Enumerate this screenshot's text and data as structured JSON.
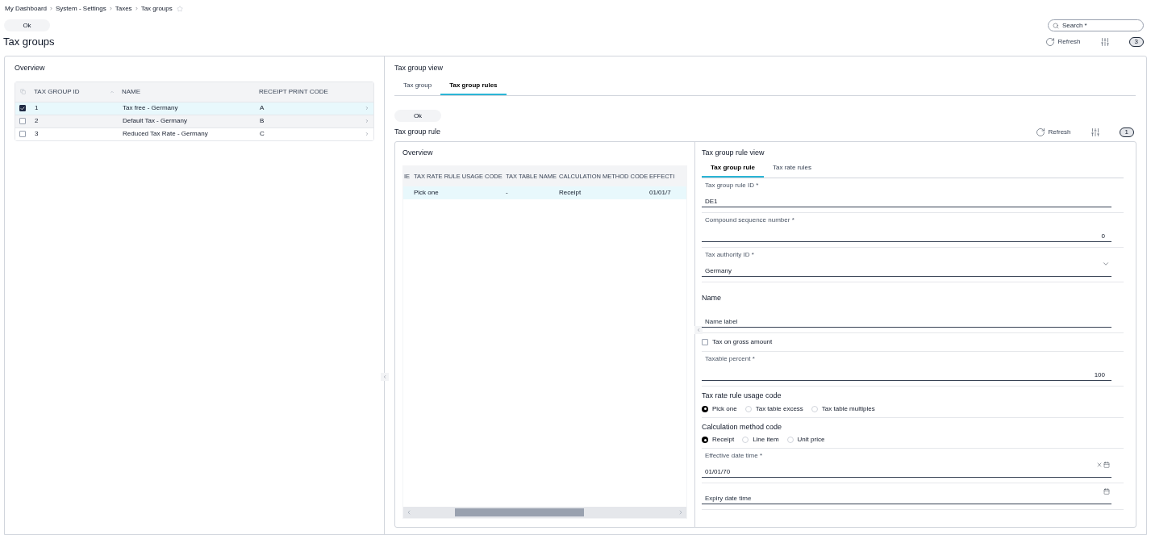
{
  "breadcrumb": [
    {
      "label": "My Dashboard"
    },
    {
      "label": "System - Settings"
    },
    {
      "label": "Taxes"
    },
    {
      "label": "Tax groups"
    }
  ],
  "favorite": false,
  "ok_button": "Ok",
  "search": {
    "placeholder": "Search *"
  },
  "page_title": "Tax groups",
  "page_actions": {
    "refresh": "Refresh",
    "count": "3"
  },
  "overview": {
    "title": "Overview",
    "columns": [
      "TAX GROUP ID",
      "NAME",
      "RECEIPT PRINT CODE"
    ],
    "rows": [
      {
        "cells": [
          "1",
          "Tax free - Germany",
          "A"
        ],
        "selected": true
      },
      {
        "cells": [
          "2",
          "Default Tax - Germany",
          "B"
        ],
        "selected": false
      },
      {
        "cells": [
          "3",
          "Reduced Tax Rate - Germany",
          "C"
        ],
        "selected": false
      }
    ]
  },
  "detail": {
    "title": "Tax group view",
    "tabs": [
      {
        "label": "Tax group",
        "selected": false
      },
      {
        "label": "Tax group rules",
        "selected": true
      }
    ],
    "ok_button": "Ok",
    "section_title": "Tax group rule",
    "actions": {
      "refresh": "Refresh",
      "count": "1"
    },
    "rules_overview": {
      "title": "Overview",
      "columns": [
        "IE",
        "TAX RATE RULE USAGE CODE",
        "TAX TABLE NAME",
        "CALCULATION METHOD CODE",
        "EFFECTI"
      ],
      "rows": [
        {
          "cells": [
            "",
            "Pick one",
            "-",
            "Receipt",
            "01/01/7"
          ],
          "selected": true
        }
      ]
    },
    "rule_view": {
      "title": "Tax group rule view",
      "tabs": [
        {
          "label": "Tax group rule",
          "selected": true
        },
        {
          "label": "Tax rate rules",
          "selected": false
        }
      ],
      "fields": [
        {
          "kind": "text",
          "label": "Tax group rule ID *",
          "value": "DE1"
        },
        {
          "kind": "number",
          "label": "Compound sequence number *",
          "value": "0"
        },
        {
          "kind": "select",
          "label": "Tax authority ID *",
          "value": "Germany"
        },
        {
          "kind": "heading",
          "label": "Name"
        },
        {
          "kind": "text",
          "placeholder": "Name label"
        },
        {
          "kind": "checkbox",
          "label": "Tax on gross amount",
          "checked": false
        },
        {
          "kind": "number",
          "label": "Taxable percent *",
          "value": "100"
        },
        {
          "kind": "radio",
          "label": "Tax rate rule usage code",
          "options": [
            {
              "label": "Pick one",
              "selected": true
            },
            {
              "label": "Tax table excess",
              "selected": false
            },
            {
              "label": "Tax table multiples",
              "selected": false
            }
          ]
        },
        {
          "kind": "radio",
          "label": "Calculation method code",
          "options": [
            {
              "label": "Receipt",
              "selected": true
            },
            {
              "label": "Line item",
              "selected": false
            },
            {
              "label": "Unit price",
              "selected": false
            }
          ]
        },
        {
          "kind": "date",
          "label": "Effective date time *",
          "value": "01/01/70",
          "clearable": true
        },
        {
          "kind": "date",
          "placeholder": "Expiry date time",
          "clearable": false
        }
      ]
    }
  }
}
